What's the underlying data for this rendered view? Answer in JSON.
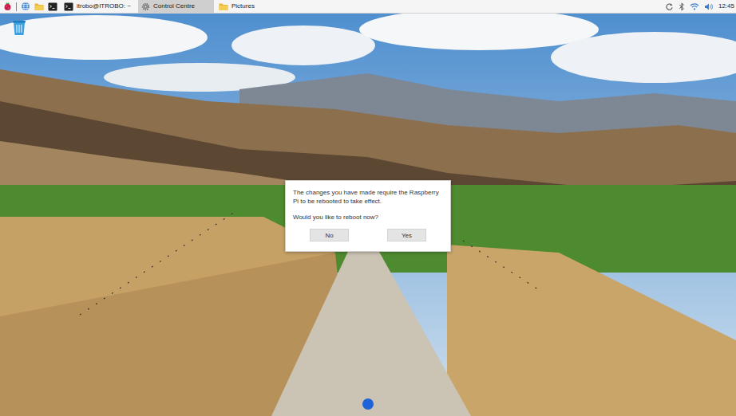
{
  "taskbar": {
    "tasks": [
      {
        "label": "itrobo@ITROBO: ~",
        "kind": "terminal",
        "selected": false
      },
      {
        "label": "Control Centre",
        "kind": "settings",
        "selected": true
      },
      {
        "label": "Pictures",
        "kind": "folder",
        "selected": false
      }
    ],
    "clock": "12:45"
  },
  "dialog": {
    "message": "The changes you have made require the Raspberry Pi to be rebooted to take effect.",
    "question": "Would you like to reboot now?",
    "buttons": [
      {
        "label": "No"
      },
      {
        "label": "Yes"
      }
    ]
  }
}
